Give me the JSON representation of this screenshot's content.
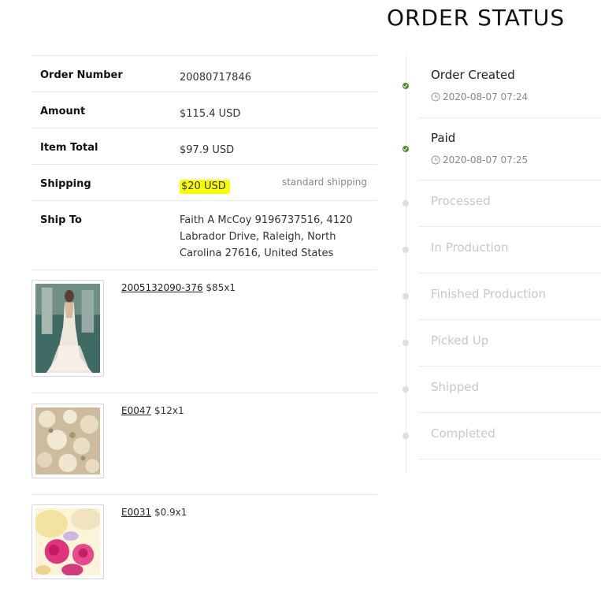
{
  "title": "ORDER STATUS",
  "order": {
    "number_label": "Order Number",
    "number": "20080717846",
    "amount_label": "Amount",
    "amount": "$115.4 USD",
    "item_total_label": "Item Total",
    "item_total": "$97.9 USD",
    "shipping_label": "Shipping",
    "shipping": "$20 USD",
    "shipping_method": "standard shipping",
    "ship_to_label": "Ship To",
    "ship_to": "Faith A McCoy 9196737516, 4120 Labrador Drive, Raleigh, North Carolina 27616, United States"
  },
  "items": [
    {
      "sku": "2005132090-376",
      "price": "$85x1",
      "image_icon": "wedding-dress-photo"
    },
    {
      "sku": "E0047",
      "price": "$12x1",
      "image_icon": "lace-fabric-photo"
    },
    {
      "sku": "E0031",
      "price": "$0.9x1",
      "image_icon": "pink-flowers-photo"
    }
  ],
  "statuses": [
    {
      "name": "Order Created",
      "time": "2020-08-07 07:24",
      "done": true
    },
    {
      "name": "Paid",
      "time": "2020-08-07 07:25",
      "done": true
    },
    {
      "name": "Processed",
      "done": false
    },
    {
      "name": "In Production",
      "done": false
    },
    {
      "name": "Finished Production",
      "done": false
    },
    {
      "name": "Picked Up",
      "done": false
    },
    {
      "name": "Shipped",
      "done": false
    },
    {
      "name": "Completed",
      "done": false
    }
  ],
  "colors": {
    "done": "#5a8a2b",
    "pending": "#c8c8c8",
    "highlight": "#f6ff00"
  }
}
